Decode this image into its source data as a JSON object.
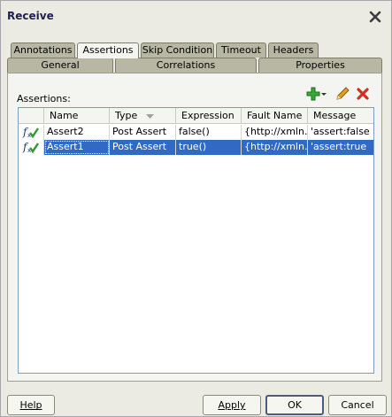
{
  "window": {
    "title": "Receive"
  },
  "tabs_back": [
    "Annotations",
    "Assertions",
    "Skip Condition",
    "Timeout",
    "Headers"
  ],
  "tabs_front": [
    "General",
    "Correlations",
    "Properties"
  ],
  "active_tab": "Assertions",
  "panel": {
    "section_label": "Assertions:",
    "toolbar": {
      "add_icon": "add-icon",
      "dropdown_icon": "dropdown-arrow-icon",
      "edit_icon": "pencil-icon",
      "delete_icon": "delete-icon"
    }
  },
  "table": {
    "columns": [
      "",
      "Name",
      "Type",
      "Expression",
      "Fault Name",
      "Message"
    ],
    "rows": [
      {
        "icon": "function-check-icon",
        "name": "Assert2",
        "type": "Post Assert",
        "expression": "false()",
        "fault_name": "{http://xmln...",
        "message": "'assert:false"
      },
      {
        "icon": "function-check-icon",
        "name": "Assert1",
        "type": "Post Assert",
        "expression": "true()",
        "fault_name": "{http://xmln...",
        "message": "'assert:true"
      }
    ],
    "selected_row": 1
  },
  "buttons": {
    "help": "Help",
    "apply": "Apply",
    "ok": "OK",
    "cancel": "Cancel"
  },
  "colors": {
    "selection": "#316ac5",
    "tab_inactive": "#b7b7a4",
    "add_green": "#2e9b2e",
    "delete_red": "#d03020"
  }
}
